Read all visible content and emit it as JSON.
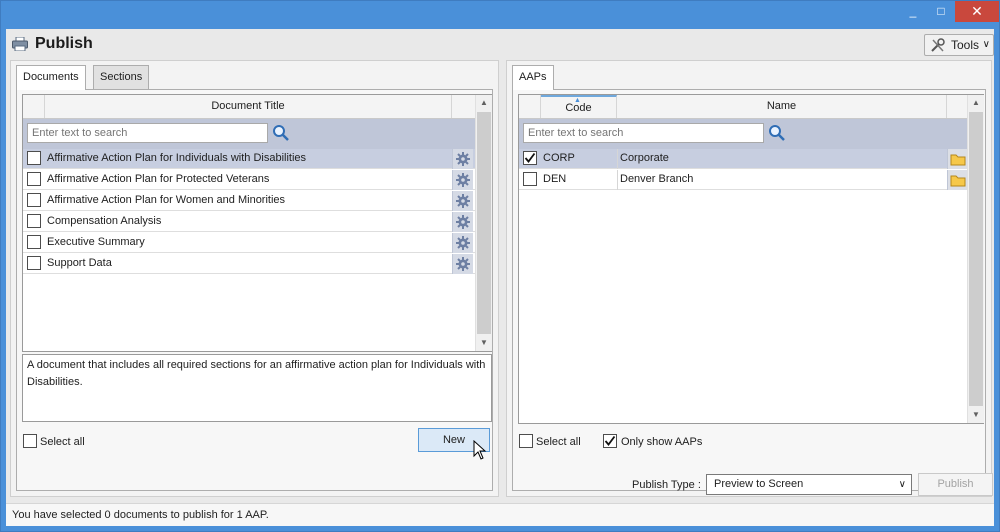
{
  "window": {
    "minimize_glyph": "_",
    "maximize_glyph": "□",
    "close_glyph": "✕"
  },
  "header": {
    "title": "Publish",
    "icon": "printer-icon",
    "tools_label": "Tools"
  },
  "left_pane": {
    "tabs": [
      {
        "label": "Documents",
        "active": true
      },
      {
        "label": "Sections",
        "active": false
      }
    ],
    "column_header": "Document Title",
    "search_placeholder": "Enter text to search",
    "documents": [
      {
        "title": "Affirmative Action Plan for Individuals with Disabilities",
        "checked": false,
        "selected": true
      },
      {
        "title": "Affirmative Action Plan for Protected Veterans",
        "checked": false,
        "selected": false
      },
      {
        "title": "Affirmative Action Plan for Women and Minorities",
        "checked": false,
        "selected": false
      },
      {
        "title": "Compensation Analysis",
        "checked": false,
        "selected": false
      },
      {
        "title": "Executive Summary",
        "checked": false,
        "selected": false
      },
      {
        "title": "Support Data",
        "checked": false,
        "selected": false
      }
    ],
    "description": "A document that includes all required sections for an affirmative action plan for Individuals with Disabilities.",
    "select_all_label": "Select all",
    "select_all_checked": false,
    "new_button_label": "New"
  },
  "right_pane": {
    "tabs": [
      {
        "label": "AAPs",
        "active": true
      }
    ],
    "columns": {
      "code": "Code",
      "name": "Name"
    },
    "search_placeholder": "Enter text to search",
    "aaps": [
      {
        "code": "CORP",
        "name": "Corporate",
        "checked": true,
        "selected": true
      },
      {
        "code": "DEN",
        "name": "Denver Branch",
        "checked": false,
        "selected": false
      }
    ],
    "select_all_label": "Select all",
    "select_all_checked": false,
    "only_show_label": "Only show AAPs",
    "only_show_checked": true
  },
  "footer": {
    "publish_type_label": "Publish Type :",
    "publish_type_value": "Preview to Screen",
    "publish_button_label": "Publish"
  },
  "status": {
    "text": "You have selected 0 documents to publish for 1 AAP."
  },
  "colors": {
    "title_bar": "#4a90d9",
    "close_button": "#c9483d",
    "selected_row": "#c7cee0",
    "search_band": "#bfc6d8"
  }
}
